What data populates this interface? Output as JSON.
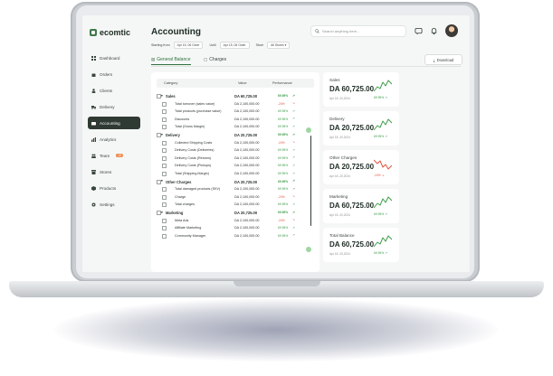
{
  "app": {
    "name": "ecomtic"
  },
  "sidebar": {
    "items": [
      {
        "label": "Dashboard",
        "icon": "grid-icon",
        "active": false
      },
      {
        "label": "Orders",
        "icon": "bag-icon",
        "active": false
      },
      {
        "label": "Clients",
        "icon": "user-icon",
        "active": false
      },
      {
        "label": "Delivery",
        "icon": "truck-icon",
        "active": false
      },
      {
        "label": "Accounting",
        "icon": "wallet-icon",
        "active": true
      },
      {
        "label": "Analytics",
        "icon": "chart-icon",
        "active": false
      },
      {
        "label": "Team",
        "icon": "team-icon",
        "active": false,
        "badge": "12"
      },
      {
        "label": "Stores",
        "icon": "store-icon",
        "active": false
      },
      {
        "label": "Products",
        "icon": "box-icon",
        "active": false
      },
      {
        "label": "Settings",
        "icon": "gear-icon",
        "active": false
      }
    ]
  },
  "header": {
    "title": "Accounting",
    "search_placeholder": "Search anything here...",
    "filters": {
      "starting_label": "Starting from",
      "starting_value": "Apr 15, 06 Octer",
      "until_label": "Until",
      "until_value": "Apr 15, 06 Octer",
      "store_label": "Store",
      "store_value": "All Stores"
    }
  },
  "tabs": [
    {
      "label": "General Balance",
      "active": true
    },
    {
      "label": "Charges",
      "active": false
    }
  ],
  "download_label": "Download",
  "table": {
    "headers": {
      "category": "Category",
      "value": "Value",
      "performance": "Performance"
    },
    "rows": [
      {
        "type": "group",
        "label": "Sales",
        "value": "DA 60,725.00",
        "perf": "69.95%",
        "dir": "up"
      },
      {
        "type": "item",
        "label": "Total turnover (sales value)",
        "value": "DA 2,100,000.00",
        "perf": "-24%",
        "dir": "down"
      },
      {
        "type": "item",
        "label": "Total products (purchase value)",
        "value": "DA 2,100,000.00",
        "perf": "69.95%",
        "dir": "up"
      },
      {
        "type": "item",
        "label": "Discounts",
        "value": "DA 2,100,000.00",
        "perf": "69.95%",
        "dir": "up"
      },
      {
        "type": "item",
        "label": "Total (Gross Margin)",
        "value": "DA 2,100,000.00",
        "perf": "69.95%",
        "dir": "up"
      },
      {
        "type": "group",
        "label": "Delivery",
        "value": "DA 20,725.00",
        "perf": "69.95%",
        "dir": "up"
      },
      {
        "type": "item",
        "label": "Collected Shipping Costs",
        "value": "DA 2,100,000.00",
        "perf": "-24%",
        "dir": "down"
      },
      {
        "type": "item",
        "label": "Delivery Costs (Deliveries)",
        "value": "DA 2,100,000.00",
        "perf": "69.95%",
        "dir": "up"
      },
      {
        "type": "item",
        "label": "Delivery Costs (Returns)",
        "value": "DA 2,100,000.00",
        "perf": "69.95%",
        "dir": "up"
      },
      {
        "type": "item",
        "label": "Delivery Costs (Pickups)",
        "value": "DA 2,100,000.00",
        "perf": "69.95%",
        "dir": "up"
      },
      {
        "type": "item",
        "label": "Total (Shipping Margin)",
        "value": "DA 2,100,000.00",
        "perf": "69.95%",
        "dir": "up"
      },
      {
        "type": "group",
        "label": "Other Charges",
        "value": "DA 20,725.00",
        "perf": "69.95%",
        "dir": "up"
      },
      {
        "type": "item",
        "label": "Total damaged products (SKV)",
        "value": "DA 2,100,000.00",
        "perf": "69.95%",
        "dir": "up"
      },
      {
        "type": "item",
        "label": "Charge",
        "value": "DA 2,100,000.00",
        "perf": "-24%",
        "dir": "down"
      },
      {
        "type": "item",
        "label": "Total charges",
        "value": "DA 2,100,000.00",
        "perf": "69.95%",
        "dir": "up"
      },
      {
        "type": "group",
        "label": "Marketing",
        "value": "DA 20,725.00",
        "perf": "69.95%",
        "dir": "up"
      },
      {
        "type": "item",
        "label": "Meta Ads",
        "value": "DA 2,100,000.00",
        "perf": "-24%",
        "dir": "down"
      },
      {
        "type": "item",
        "label": "Affiliate Marketing",
        "value": "DA 2,100,000.00",
        "perf": "69.95%",
        "dir": "up"
      },
      {
        "type": "item",
        "label": "Community Manager",
        "value": "DA 2,100,000.00",
        "perf": "69.95%",
        "dir": "up"
      }
    ]
  },
  "kpis": [
    {
      "title": "Sales",
      "value": "DA 60,725.00",
      "date": "Apr 18 -20,2024",
      "perf": "69.95%",
      "dir": "up"
    },
    {
      "title": "Delivery",
      "value": "DA 20,725.00",
      "date": "Apr 18 -20,2024",
      "perf": "69.95%",
      "dir": "up"
    },
    {
      "title": "Other Charges",
      "value": "DA 20,725.00",
      "date": "Apr 18 -20,2024",
      "perf": "-24%",
      "dir": "down"
    },
    {
      "title": "Marketing",
      "value": "DA 60,725.00",
      "date": "Apr 18 -20,2024",
      "perf": "69.95%",
      "dir": "up"
    },
    {
      "title": "Total Balance",
      "value": "DA 60,725.00",
      "date": "Apr 18 -20,2024",
      "perf": "69.95%",
      "dir": "up"
    }
  ],
  "colors": {
    "accent": "#2f6f3b",
    "positive": "#3f9d4b",
    "negative": "#e0563f",
    "active_nav": "#2f3a33",
    "badge": "#f08a4b"
  },
  "arrows": {
    "up": "↗",
    "down": "↘"
  }
}
